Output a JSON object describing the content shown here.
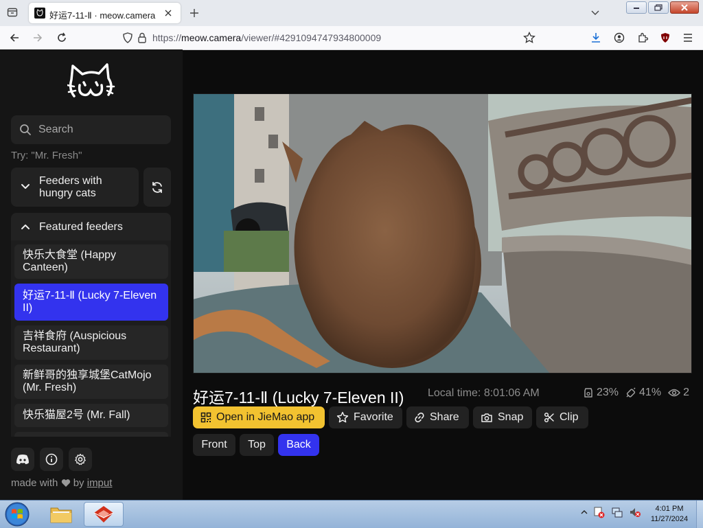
{
  "browser": {
    "tab_title": "好运7-11-Ⅱ · meow.camera",
    "url_prefix": "https://",
    "url_host": "meow.camera",
    "url_path": "/viewer/#4291094747934800009"
  },
  "sidebar": {
    "search_placeholder": "Search",
    "try_hint": "Try: \"Mr. Fresh\"",
    "hungry_label": "Feeders with hungry cats",
    "featured_label": "Featured feeders",
    "feeders": [
      {
        "label": "快乐大食堂 (Happy Canteen)"
      },
      {
        "label": "好运7-11-Ⅱ (Lucky 7-Eleven II)"
      },
      {
        "label": "吉祥食府 (Auspicious Restaurant)"
      },
      {
        "label": "新鲜哥的独享城堡CatMojo (Mr. Fresh)"
      },
      {
        "label": "快乐猫屋2号 (Mr. Fall)"
      }
    ],
    "made_with_prefix": "made with",
    "made_with_by": "by",
    "author": "imput"
  },
  "main": {
    "feeder_title": "好运7-11-Ⅱ (Lucky 7-Eleven II)",
    "local_time": "Local time: 8:01:06 AM",
    "stats": {
      "food": "23%",
      "battery": "41%",
      "viewers": "2"
    },
    "actions": {
      "open_app": "Open in JieMao app",
      "favorite": "Favorite",
      "share": "Share",
      "snap": "Snap",
      "clip": "Clip"
    },
    "views": {
      "front": "Front",
      "top": "Top",
      "back": "Back"
    }
  },
  "taskbar": {
    "time": "4:01 PM",
    "date": "11/27/2024"
  },
  "colors": {
    "accent_blue": "#3333ee",
    "accent_yellow": "#f2c230",
    "sidebar_bg": "#151515"
  }
}
